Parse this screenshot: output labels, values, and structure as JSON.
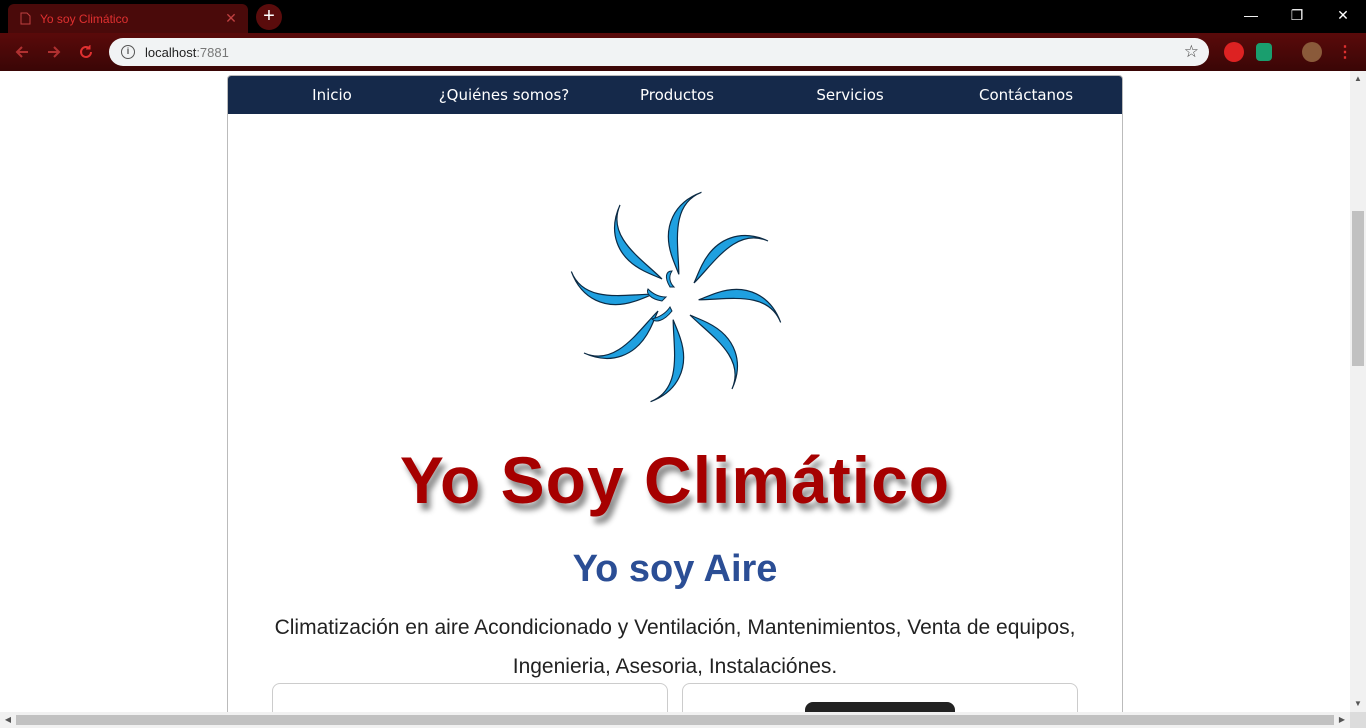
{
  "browser": {
    "tab_title": "Yo soy Climático",
    "tab_close": "✕",
    "new_tab": "+",
    "url_host": "localhost",
    "url_port": ":7881",
    "window_controls": {
      "minimize": "—",
      "restore": "❐",
      "close": "✕"
    },
    "icons": [
      "back-arrow-icon",
      "forward-arrow-icon",
      "reload-icon",
      "info-icon",
      "star-icon",
      "extension-icon",
      "profile-avatar",
      "menu-icon"
    ]
  },
  "nav": {
    "items": [
      {
        "label": "Inicio"
      },
      {
        "label": "¿Quiénes somos?"
      },
      {
        "label": "Productos"
      },
      {
        "label": "Servicios"
      },
      {
        "label": "Contáctanos"
      }
    ],
    "background": "#15294a"
  },
  "hero": {
    "brand": "Yo Soy Climático",
    "slogan": "Yo soy Aire",
    "description": "Climatización en aire Acondicionado y Ventilación, Mantenimientos, Venta de equipos, Ingenieria, Asesoria, Instalaciónes.",
    "brand_color": "#a60000",
    "slogan_color": "#2b4e95",
    "logo_color": "#1fa0e0"
  }
}
